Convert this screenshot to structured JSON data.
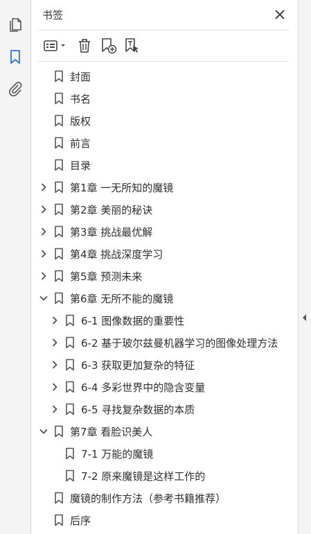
{
  "panel": {
    "title": "书签"
  },
  "rail": {
    "icons": [
      "pages-icon",
      "bookmark-icon",
      "attachment-icon"
    ]
  },
  "toolbar": {
    "buttons": [
      "options-menu-icon",
      "delete-bookmark-icon",
      "new-bookmark-icon",
      "bookmark-from-selection-icon"
    ]
  },
  "bookmarks": [
    {
      "label": "封面",
      "level": 0,
      "expander": "none"
    },
    {
      "label": "书名",
      "level": 0,
      "expander": "none"
    },
    {
      "label": "版权",
      "level": 0,
      "expander": "none"
    },
    {
      "label": "前言",
      "level": 0,
      "expander": "none"
    },
    {
      "label": "目录",
      "level": 0,
      "expander": "none"
    },
    {
      "label": "第1章  一无所知的魔镜",
      "level": 0,
      "expander": "collapsed"
    },
    {
      "label": "第2章  美丽的秘诀",
      "level": 0,
      "expander": "collapsed"
    },
    {
      "label": "第3章  挑战最优解",
      "level": 0,
      "expander": "collapsed"
    },
    {
      "label": "第4章  挑战深度学习",
      "level": 0,
      "expander": "collapsed"
    },
    {
      "label": "第5章  预测未来",
      "level": 0,
      "expander": "collapsed"
    },
    {
      "label": "第6章  无所不能的魔镜",
      "level": 0,
      "expander": "expanded"
    },
    {
      "label": "6-1  图像数据的重要性",
      "level": 1,
      "expander": "collapsed"
    },
    {
      "label": "6-2  基于玻尔兹曼机器学习的图像处理方法",
      "level": 1,
      "expander": "collapsed"
    },
    {
      "label": "6-3  获取更加复杂的特征",
      "level": 1,
      "expander": "collapsed"
    },
    {
      "label": "6-4  多彩世界中的隐含变量",
      "level": 1,
      "expander": "collapsed"
    },
    {
      "label": "6-5  寻找复杂数据的本质",
      "level": 1,
      "expander": "collapsed"
    },
    {
      "label": "第7章  看脸识美人",
      "level": 0,
      "expander": "expanded"
    },
    {
      "label": "7-1  万能的魔镜",
      "level": 1,
      "expander": "none"
    },
    {
      "label": "7-2  原来魔镜是这样工作的",
      "level": 1,
      "expander": "none"
    },
    {
      "label": "魔镜的制作方法（参考书籍推荐）",
      "level": 0,
      "expander": "none"
    },
    {
      "label": "后序",
      "level": 0,
      "expander": "none"
    }
  ],
  "colors": {
    "accent": "#2f6fd6",
    "icon": "#555555",
    "rail": "#f4f4f4",
    "divider": "#dcdcdc"
  }
}
